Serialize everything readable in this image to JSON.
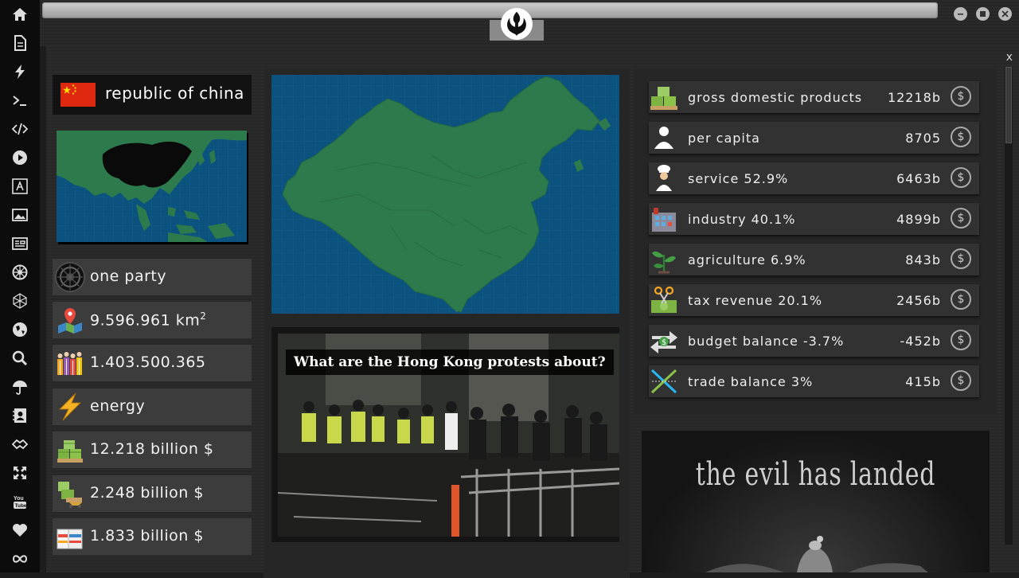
{
  "rail": {
    "icons": [
      "home-icon",
      "document-icon",
      "lightning-icon",
      "terminal-icon",
      "code-icon",
      "play-icon",
      "translate-icon",
      "image-icon",
      "newspaper-icon",
      "empire-emblem-icon",
      "polyhedron-icon",
      "globe-icon",
      "search-icon",
      "umbrella-icon",
      "contact-card-icon",
      "handshake-icon",
      "expand-icon",
      "youtube-icon",
      "heart-icon",
      "infinity-icon"
    ]
  },
  "topbar": {
    "logo": "rebel-alliance-icon"
  },
  "panel": {
    "close_label": "x"
  },
  "country": {
    "name": "republic of china",
    "flag": {
      "color": "#de2910",
      "star_color": "#ffde00"
    },
    "government": "one party",
    "area_value": "9.596.961 km",
    "area_exp": "2",
    "population": "1.403.500.365",
    "resource": "energy",
    "gdp_billion": "12.218 billion $",
    "exports_billion": "2.248 billion $",
    "imports_billion": "1.833 billion $"
  },
  "news": {
    "headline": "What are the Hong Kong protests about?"
  },
  "economy": {
    "currency_symbol": "$",
    "rows": [
      {
        "label": "gross domestic products",
        "value": "12218b",
        "icon": "cash-pallet-icon"
      },
      {
        "label": "per capita",
        "value": "8705",
        "icon": "person-icon"
      },
      {
        "label": "service 52.9%",
        "value": "6463b",
        "icon": "chef-icon"
      },
      {
        "label": "industry 40.1%",
        "value": "4899b",
        "icon": "factory-icon"
      },
      {
        "label": "agriculture 6.9%",
        "value": "843b",
        "icon": "sprout-icon"
      },
      {
        "label": "tax revenue 20.1%",
        "value": "2456b",
        "icon": "tax-scissors-icon"
      },
      {
        "label": "budget balance -3.7%",
        "value": "-452b",
        "icon": "exchange-arrows-icon"
      },
      {
        "label": "trade balance 3%",
        "value": "415b",
        "icon": "trade-cross-icon"
      }
    ]
  },
  "promo": {
    "title": "the evil has landed"
  },
  "colors": {
    "map_sea": "#0b527f",
    "map_land": "#2d7a4c",
    "highlight_land": "#0a0a0a"
  }
}
